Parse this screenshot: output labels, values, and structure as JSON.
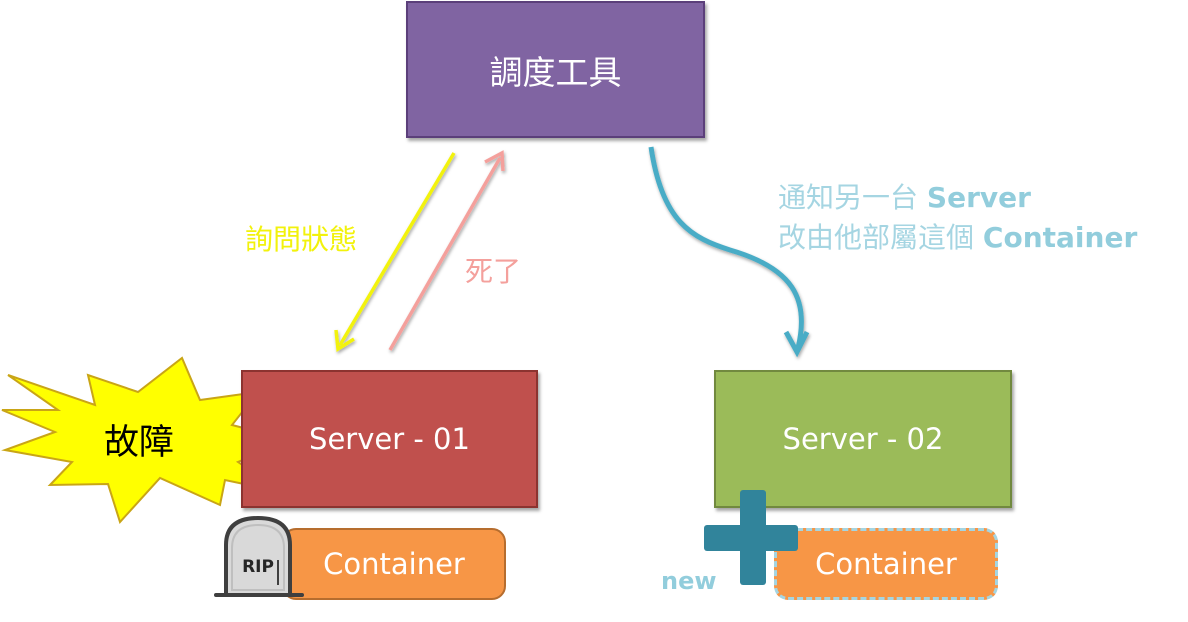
{
  "scheduler": {
    "label": "調度工具"
  },
  "server01": {
    "label": "Server - 01"
  },
  "server02": {
    "label": "Server - 02"
  },
  "container_old": {
    "label": "Container"
  },
  "container_new": {
    "label": "Container",
    "new_label": "new"
  },
  "arrows": {
    "query_label": "詢問狀態",
    "dead_label": "死了",
    "notify_line1_text": "通知另一台",
    "notify_line1_bold": "Server",
    "notify_line2_text": "改由他部屬這個",
    "notify_line2_bold": "Container"
  },
  "failure": {
    "label": "故障"
  },
  "tombstone": {
    "text": "RIP"
  },
  "colors": {
    "scheduler": "#8064a2",
    "server01": "#c0504d",
    "server02": "#9bbb59",
    "container": "#f79646",
    "query_arrow": "#f2f20c",
    "dead_arrow": "#f4a09c",
    "notify_arrow": "#4aacc6",
    "plus": "#31849b"
  }
}
